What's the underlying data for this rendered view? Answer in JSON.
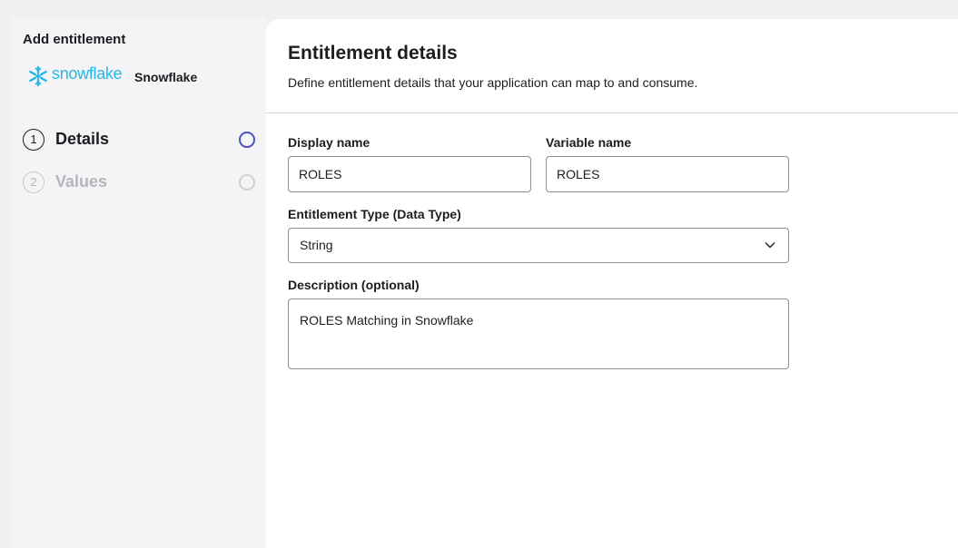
{
  "sidebar": {
    "title": "Add entitlement",
    "app": {
      "logo_text": "snowflake",
      "name": "Snowflake"
    },
    "steps": [
      {
        "number": "1",
        "label": "Details",
        "state": "active"
      },
      {
        "number": "2",
        "label": "Values",
        "state": "inactive"
      }
    ]
  },
  "main": {
    "title": "Entitlement details",
    "subtitle": "Define entitlement details that your application can map to and consume.",
    "form": {
      "display_name": {
        "label": "Display name",
        "value": "ROLES"
      },
      "variable_name": {
        "label": "Variable name",
        "value": "ROLES"
      },
      "entitlement_type": {
        "label": "Entitlement Type (Data Type)",
        "value": "String"
      },
      "description": {
        "label": "Description (optional)",
        "value": "ROLES Matching in Snowflake"
      }
    }
  },
  "colors": {
    "snowflake_blue": "#29b5e8",
    "active_step": "#4b4fc4",
    "inactive_step": "#b5b5ba"
  }
}
